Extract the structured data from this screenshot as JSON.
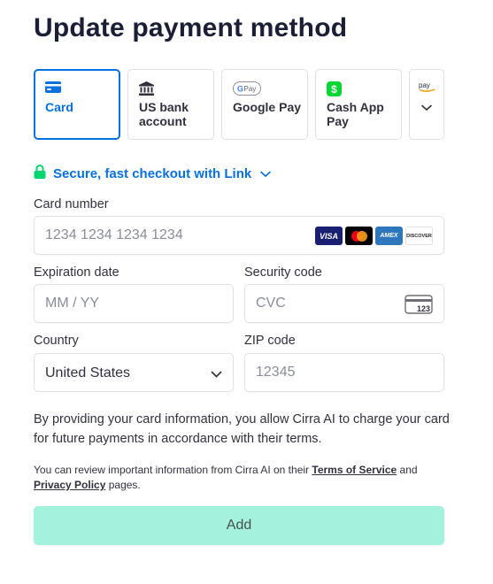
{
  "page": {
    "title": "Update payment method"
  },
  "methods": [
    {
      "label": "Card",
      "icon": "card-icon"
    },
    {
      "label": "US bank account",
      "icon": "bank-icon"
    },
    {
      "label": "Google Pay",
      "icon": "google-pay-icon"
    },
    {
      "label": "Cash App Pay",
      "icon": "cash-app-icon"
    },
    {
      "label": "",
      "icon": "amazon-pay-icon"
    }
  ],
  "link": {
    "label": "Secure, fast checkout with Link"
  },
  "card_number": {
    "label": "Card number",
    "placeholder": "1234 1234 1234 1234"
  },
  "brands": [
    {
      "name": "VISA",
      "color": "#1a1f71"
    },
    {
      "name": "mastercard",
      "color": "#000000"
    },
    {
      "name": "AMEX",
      "color": "#2e77bc"
    },
    {
      "name": "DISCOVER",
      "color": "#ffffff"
    }
  ],
  "expiry": {
    "label": "Expiration date",
    "placeholder": "MM / YY"
  },
  "cvc": {
    "label": "Security code",
    "placeholder": "CVC"
  },
  "country": {
    "label": "Country",
    "value": "United States"
  },
  "zip": {
    "label": "ZIP code",
    "placeholder": "12345"
  },
  "consent": {
    "text": "By providing your card information, you allow Cirra AI to charge your card for future payments in accordance with their terms."
  },
  "terms": {
    "prefix": "You can review important information from Cirra AI on their ",
    "tos": "Terms of Service",
    "middle": " and",
    "privacy": "Privacy Policy",
    "suffix": " pages."
  },
  "add_button": {
    "label": "Add"
  },
  "colors": {
    "accent": "#0570de",
    "link_green": "#00d66f",
    "button_bg": "#a4f2de",
    "border": "#e0e0e6"
  }
}
